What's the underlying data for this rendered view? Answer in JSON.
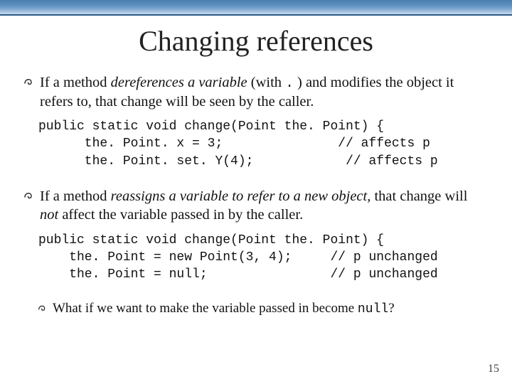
{
  "title": "Changing references",
  "bullets": {
    "b1_pre": "If a method ",
    "b1_em": "dereferences a variable ",
    "b1_post_a": " (with ",
    "b1_dot": ".",
    "b1_post_b": " ) and modifies the object it refers to, that change will be seen by the caller.",
    "b2_pre": "If a method ",
    "b2_em": "reassigns a variable to refer to a new object,",
    "b2_post_a": " that change will ",
    "b2_em2": "not",
    "b2_post_b": " affect the variable passed in by the caller.",
    "b3_pre": "What if we want to make the variable passed in become ",
    "b3_code": "null",
    "b3_post": "?"
  },
  "code1": "public static void change(Point the. Point) {\n      the. Point. x = 3;               // affects p\n      the. Point. set. Y(4);            // affects p",
  "code2": "public static void change(Point the. Point) {\n    the. Point = new Point(3, 4);     // p unchanged\n    the. Point = null;                // p unchanged",
  "slide_number": "15",
  "icons": {
    "bullet": "swirl-bullet-icon"
  }
}
